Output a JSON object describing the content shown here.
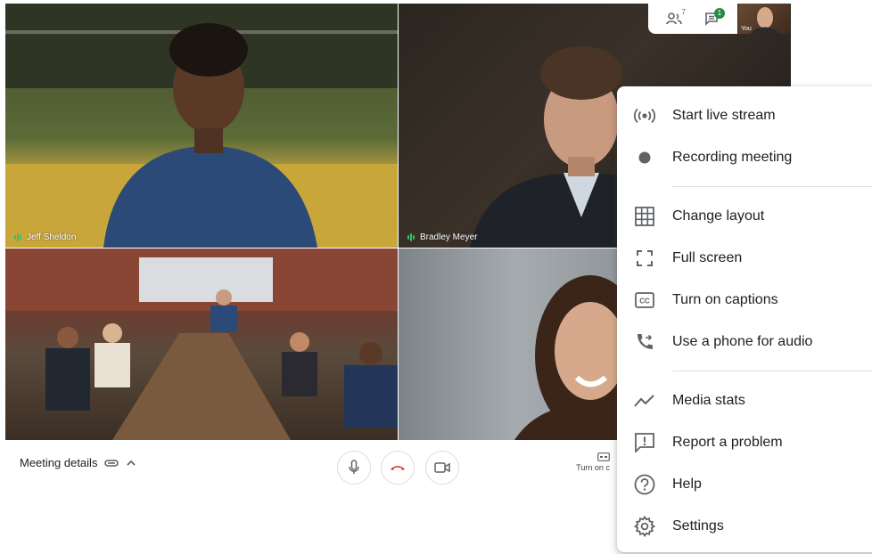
{
  "tiles": {
    "jeff": {
      "name": "Jeff Sheldon"
    },
    "bradley": {
      "name": "Bradley Meyer"
    }
  },
  "top_controls": {
    "people_count": "7",
    "chat_badge": "1",
    "self_label": "You",
    "people_icon": "people-icon",
    "chat_icon": "chat-icon"
  },
  "bottom_bar": {
    "meeting_details_label": "Meeting details",
    "captions_label": "Turn on c",
    "end_call_color": "#d93025"
  },
  "menu": {
    "items": [
      {
        "label": "Start live stream",
        "icon": "live-stream-icon"
      },
      {
        "label": "Recording meeting",
        "icon": "recording-dot-icon"
      },
      {
        "label": "Change layout",
        "icon": "grid-layout-icon"
      },
      {
        "label": "Full screen",
        "icon": "fullscreen-icon"
      },
      {
        "label": "Turn on captions",
        "icon": "captions-icon"
      },
      {
        "label": "Use a phone for audio",
        "icon": "phone-audio-icon"
      },
      {
        "label": "Media stats",
        "icon": "trend-line-icon"
      },
      {
        "label": "Report a problem",
        "icon": "report-icon"
      },
      {
        "label": "Help",
        "icon": "help-icon"
      },
      {
        "label": "Settings",
        "icon": "gear-icon"
      }
    ]
  },
  "colors": {
    "speaking": "#35c06a",
    "badge": "#1e8e3e",
    "icon": "#5f6368"
  }
}
